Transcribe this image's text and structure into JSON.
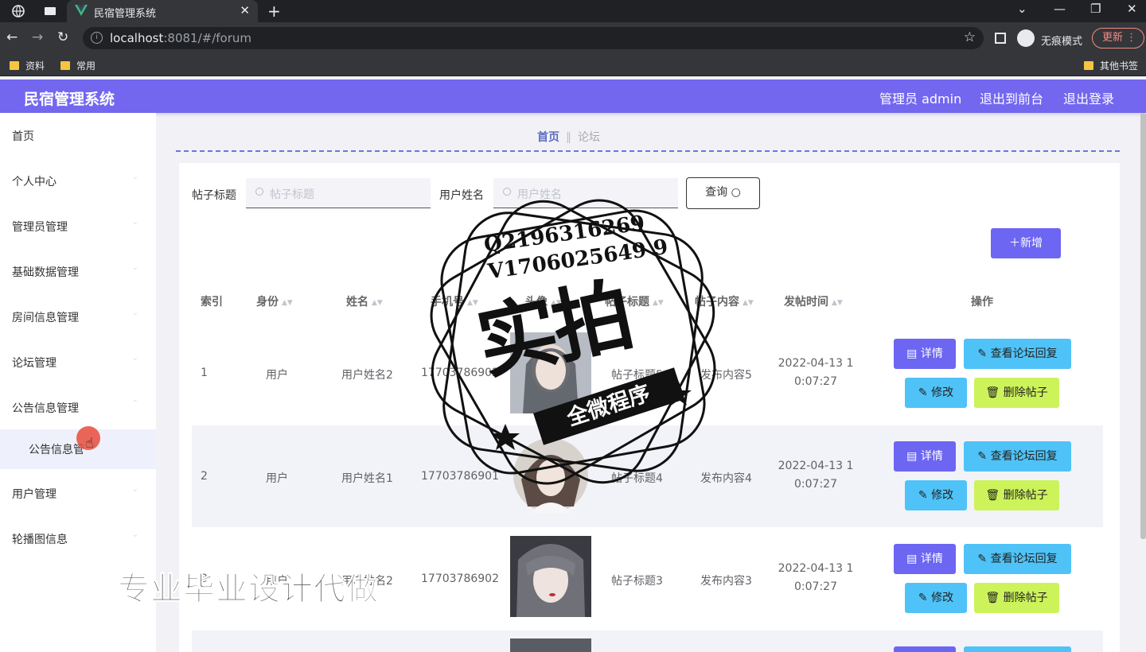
{
  "browser": {
    "tab_title": "民宿管理系统",
    "url_host": "localhost",
    "url_rest": ":8081/#/forum",
    "incognito_label": "无痕模式",
    "update_label": "更新",
    "bookmarks": [
      "资料",
      "常用"
    ],
    "other_bookmarks": "其他书签"
  },
  "header": {
    "title": "民宿管理系统",
    "admin": "管理员 admin",
    "to_front": "退出到前台",
    "logout": "退出登录"
  },
  "sidebar": {
    "items": [
      "首页",
      "个人中心",
      "管理员管理",
      "基础数据管理",
      "房间信息管理",
      "论坛管理",
      "公告信息管理",
      "用户管理",
      "轮播图信息"
    ],
    "sub_item": "公告信息管"
  },
  "breadcrumb": {
    "home": "首页",
    "current": "论坛"
  },
  "search": {
    "title_label": "帖子标题",
    "title_placeholder": "帖子标题",
    "name_label": "用户姓名",
    "name_placeholder": "用户姓名",
    "query_label": "查询",
    "add_label": "新增"
  },
  "table": {
    "headers": {
      "index": "索引",
      "role": "身份",
      "name": "姓名",
      "phone": "手机号",
      "avatar": "头像",
      "post_title": "帖子标题",
      "content": "帖子内容",
      "time": "发帖时间",
      "ops": "操作"
    },
    "rows": [
      {
        "index": "1",
        "role": "用户",
        "name": "用户姓名2",
        "phone": "17703786902",
        "title": "帖子标题5",
        "content": "发布内容5",
        "time1": "2022-04-13 1",
        "time2": "0:07:27"
      },
      {
        "index": "2",
        "role": "用户",
        "name": "用户姓名1",
        "phone": "17703786901",
        "title": "帖子标题4",
        "content": "发布内容4",
        "time1": "2022-04-13 1",
        "time2": "0:07:27"
      },
      {
        "index": "3",
        "role": "用户",
        "name": "用户姓名2",
        "phone": "17703786902",
        "title": "帖子标题3",
        "content": "发布内容3",
        "time1": "2022-04-13 1",
        "time2": "0:07:27"
      }
    ],
    "buttons": {
      "detail": "详情",
      "reply": "查看论坛回复",
      "edit": "修改",
      "delete": "删除帖子"
    }
  },
  "overlay": {
    "stamp_q": "Q2196316269",
    "stamp_v": "V1706025649 9",
    "stamp_big": "实拍",
    "stamp_band": "全微程序",
    "watermark": "专业毕业设计代做"
  },
  "colors": {
    "primary": "#7367f0",
    "detail_btn": "#6c66f2",
    "reply_btn": "#4fc3f7",
    "delete_btn": "#ccf35a"
  }
}
